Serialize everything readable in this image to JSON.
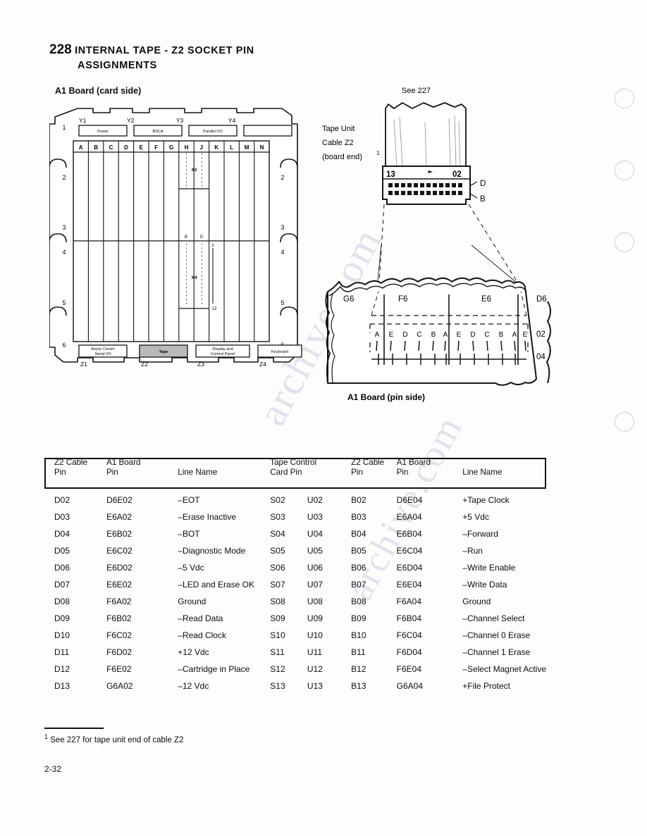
{
  "page": {
    "section_number": "228",
    "title_line1": "INTERNAL TAPE - Z2 SOCKET PIN",
    "title_line2": "ASSIGNMENTS",
    "folio": "2-32",
    "footnote_marker": "1",
    "footnote_text": "See 227 for tape unit end of cable Z2",
    "watermark": "archive.com"
  },
  "board_card_side": {
    "caption": "A1 Board (card side)",
    "row_numbers": [
      "1",
      "2",
      "3",
      "4",
      "5",
      "6"
    ],
    "column_letters": [
      "A",
      "B",
      "C",
      "D",
      "E",
      "F",
      "G",
      "H",
      "J",
      "K",
      "L",
      "M",
      "N"
    ],
    "top_connectors": [
      {
        "id": "Y1",
        "label": "Power"
      },
      {
        "id": "Y2",
        "label": "BSCA"
      },
      {
        "id": "Y3",
        "label": "Parallel I/O"
      },
      {
        "id": "Y4",
        "label": ""
      }
    ],
    "bottom_connectors": [
      {
        "id": "Z1",
        "label": "Async Comm\nSerial I/O",
        "label_l1": "Async Comm",
        "label_l2": "Serial I/O",
        "highlighted": false
      },
      {
        "id": "Z2",
        "label": "Tape",
        "label_l1": "Tape",
        "label_l2": "",
        "highlighted": true
      },
      {
        "id": "Z3",
        "label": "Display and\nControl Panel",
        "label_l1": "Display and",
        "label_l2": "Control Panel",
        "highlighted": false
      },
      {
        "id": "Z4",
        "label": "Keyboard",
        "label_l1": "Keyboard",
        "label_l2": "",
        "highlighted": false
      }
    ],
    "inner_markers": {
      "x2_label": "X2",
      "x4_label": "X4",
      "pin_b": "B",
      "pin_d": "D",
      "pin_top_num": "2",
      "pin_bottom_num": "13"
    }
  },
  "cable_diagram": {
    "see_ref": "See 227",
    "cable_label_l1": "Tape Unit",
    "cable_label_l2": "Cable Z2",
    "cable_label_l3": "(board end)",
    "cable_label_sup": "1",
    "connector_pin_high": "13",
    "connector_pin_low": "02",
    "row_label_top": "D",
    "row_label_bottom": "B",
    "connector_pin_count": 12
  },
  "board_pin_side": {
    "caption": "A1 Board (pin side)",
    "group_labels": [
      "G6",
      "F6",
      "E6",
      "D6"
    ],
    "pin_letters": [
      "A",
      "E",
      "D",
      "C",
      "B",
      "A",
      "E",
      "D",
      "C",
      "B",
      "A",
      "E"
    ],
    "row_label_top": "02",
    "row_label_bottom": "04"
  },
  "table": {
    "headers": {
      "z2_cable_pin_l1": "Z2 Cable",
      "z2_cable_pin_l2": "Pin",
      "a1_board_pin_l1": "A1 Board",
      "a1_board_pin_l2": "Pin",
      "line_name": "Line Name",
      "tape_control_l1": "Tape Control",
      "tape_control_l2": "Card Pin",
      "z2_cable_pin_b_l1": "Z2 Cable",
      "z2_cable_pin_b_l2": "Pin",
      "a1_board_pin_b_l1": "A1 Board",
      "a1_board_pin_b_l2": "Pin",
      "line_name_b": "Line Name"
    },
    "rows": [
      {
        "z2_d": "D02",
        "a1_d": "D6E02",
        "line_d": "–EOT",
        "tc_s": "S02",
        "tc_u": "U02",
        "z2_b": "B02",
        "a1_b": "D6E04",
        "line_b": "+Tape Clock"
      },
      {
        "z2_d": "D03",
        "a1_d": "E6A02",
        "line_d": "–Erase Inactive",
        "tc_s": "S03",
        "tc_u": "U03",
        "z2_b": "B03",
        "a1_b": "E6A04",
        "line_b": "+5 Vdc"
      },
      {
        "z2_d": "D04",
        "a1_d": "E6B02",
        "line_d": "–BOT",
        "tc_s": "S04",
        "tc_u": "U04",
        "z2_b": "B04",
        "a1_b": "E6B04",
        "line_b": "–Forward"
      },
      {
        "z2_d": "D05",
        "a1_d": "E6C02",
        "line_d": "–Diagnostic Mode",
        "tc_s": "S05",
        "tc_u": "U05",
        "z2_b": "B05",
        "a1_b": "E6C04",
        "line_b": "–Run"
      },
      {
        "z2_d": "D06",
        "a1_d": "E6D02",
        "line_d": "–5 Vdc",
        "tc_s": "S06",
        "tc_u": "U06",
        "z2_b": "B06",
        "a1_b": "E6D04",
        "line_b": "–Write Enable"
      },
      {
        "z2_d": "D07",
        "a1_d": "E6E02",
        "line_d": "–LED and Erase OK",
        "tc_s": "S07",
        "tc_u": "U07",
        "z2_b": "B07",
        "a1_b": "E6E04",
        "line_b": "–Write Data"
      },
      {
        "z2_d": "D08",
        "a1_d": "F6A02",
        "line_d": "Ground",
        "tc_s": "S08",
        "tc_u": "U08",
        "z2_b": "B08",
        "a1_b": "F6A04",
        "line_b": "Ground"
      },
      {
        "z2_d": "D09",
        "a1_d": "F6B02",
        "line_d": "–Read Data",
        "tc_s": "S09",
        "tc_u": "U09",
        "z2_b": "B09",
        "a1_b": "F6B04",
        "line_b": "–Channel Select"
      },
      {
        "z2_d": "D10",
        "a1_d": "F6C02",
        "line_d": "–Read Clock",
        "tc_s": "S10",
        "tc_u": "U10",
        "z2_b": "B10",
        "a1_b": "F6C04",
        "line_b": "–Channel 0 Erase"
      },
      {
        "z2_d": "D11",
        "a1_d": "F6D02",
        "line_d": "+12 Vdc",
        "tc_s": "S11",
        "tc_u": "U11",
        "z2_b": "B11",
        "a1_b": "F6D04",
        "line_b": "–Channel 1 Erase"
      },
      {
        "z2_d": "D12",
        "a1_d": "F6E02",
        "line_d": "–Cartridge in Place",
        "tc_s": "S12",
        "tc_u": "U12",
        "z2_b": "B12",
        "a1_b": "F6E04",
        "line_b": "–Select Magnet Active"
      },
      {
        "z2_d": "D13",
        "a1_d": "G6A02",
        "line_d": "–12 Vdc",
        "tc_s": "S13",
        "tc_u": "U13",
        "z2_b": "B13",
        "a1_b": "G6A04",
        "line_b": "+File Protect"
      }
    ]
  }
}
